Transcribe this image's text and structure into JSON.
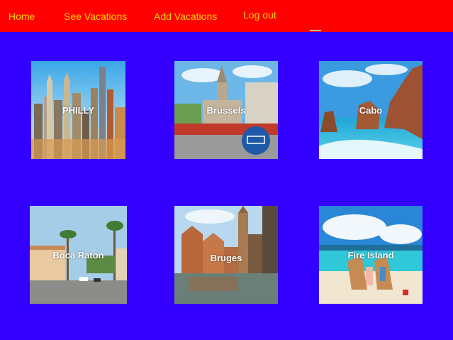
{
  "nav": {
    "home": "Home",
    "see_vacations": "See Vacations",
    "add_vacations": "Add Vacations",
    "log_out": "Log out"
  },
  "vacations": [
    {
      "name": "PHILLY"
    },
    {
      "name": "Brussels"
    },
    {
      "name": "Cabo"
    },
    {
      "name": "Boca Raton"
    },
    {
      "name": "Bruges"
    },
    {
      "name": "Fire Island"
    }
  ],
  "colors": {
    "background": "#3300ff",
    "navbar": "#ff0000",
    "nav_text": "#ffd300",
    "card_label": "#ffffff"
  }
}
